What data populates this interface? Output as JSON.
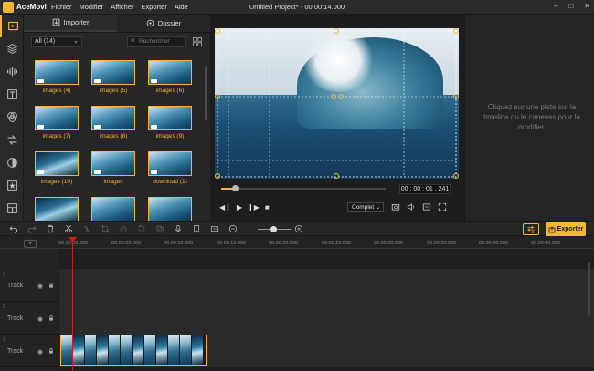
{
  "app": {
    "name": "AceMovi",
    "menu": [
      "Fichier",
      "Modifier",
      "Afficher",
      "Exporter",
      "Aide"
    ],
    "window_title": "Untitled Project* - 00:00:14.000"
  },
  "media": {
    "tabs": [
      {
        "label": "Importer",
        "icon": "import-icon"
      },
      {
        "label": "Dossier",
        "icon": "folder-icon"
      }
    ],
    "filter": "All (14)",
    "search_placeholder": "Rechercher",
    "items": [
      {
        "label": "images (4)",
        "style": "light"
      },
      {
        "label": "images (5)",
        "style": "light"
      },
      {
        "label": "images (6)",
        "style": "light"
      },
      {
        "label": "images (7)",
        "style": "light"
      },
      {
        "label": "images (8)",
        "style": "light"
      },
      {
        "label": "images (9)",
        "style": "light"
      },
      {
        "label": "images (10)",
        "style": "dark"
      },
      {
        "label": "images",
        "style": "light"
      },
      {
        "label": "download (1)",
        "style": "light"
      },
      {
        "label": "",
        "style": "light"
      },
      {
        "label": "",
        "style": "light"
      },
      {
        "label": "",
        "style": "light"
      }
    ]
  },
  "preview": {
    "timecode": "00 : 00 : 01 . 241",
    "quality": "Complet",
    "progress": 0.08
  },
  "properties": {
    "hint": "Cliquez sur une piste sur la timeline ou le canevas pour la modifier."
  },
  "toolbar": {
    "export_label": "Exporter"
  },
  "timeline": {
    "ruler": [
      "00:00:00.000",
      "00:00:05.000",
      "00:00:10.000",
      "00:00:15.000",
      "00:00:20.000",
      "00:00:25.000",
      "00:00:30.000",
      "00:00:35.000",
      "00:00:40.000",
      "00:00:45.000"
    ],
    "tracks": [
      {
        "num": "3",
        "name": "Track"
      },
      {
        "num": "2",
        "name": "Track"
      },
      {
        "num": "1",
        "name": "Track"
      }
    ],
    "clip_frames": 12
  },
  "colors": {
    "accent": "#f2b632",
    "playhead": "#d11a1a"
  }
}
